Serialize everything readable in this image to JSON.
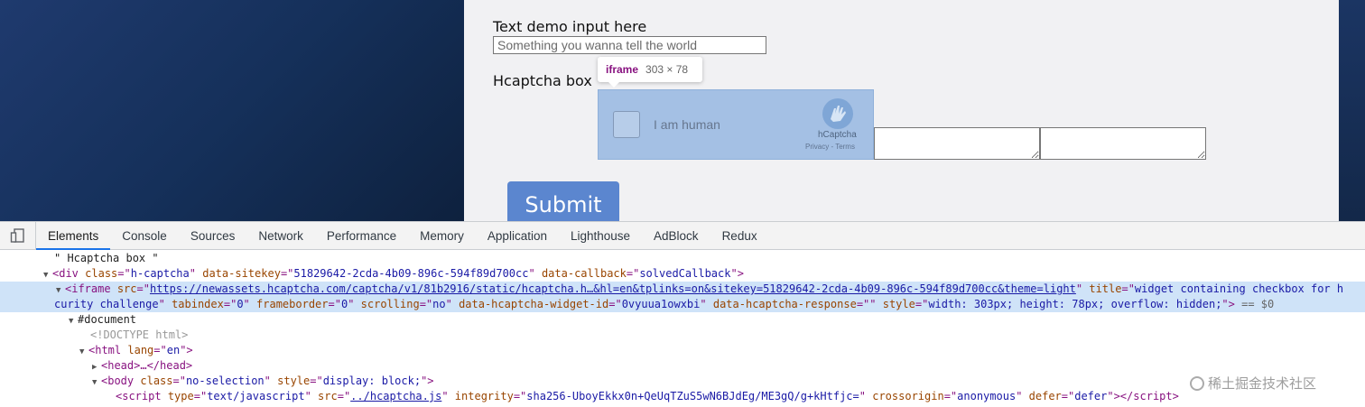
{
  "page": {
    "text_label": "Text demo input here",
    "text_placeholder": "Something you wanna tell the world",
    "captcha_label": "Hcaptcha box",
    "captcha_checkbox_text": "I am human",
    "captcha_brand": "hCaptcha",
    "captcha_links": "Privacy - Terms",
    "submit_label": "Submit"
  },
  "tooltip": {
    "tag": "iframe",
    "dims": "303 × 78"
  },
  "devtools": {
    "tabs": [
      "Elements",
      "Console",
      "Sources",
      "Network",
      "Performance",
      "Memory",
      "Application",
      "Lighthouse",
      "AdBlock",
      "Redux"
    ],
    "active_tab": "Elements"
  },
  "dom": {
    "text_node": "\" Hcaptcha box \"",
    "div_tag": "div",
    "div_class_attr": "class",
    "div_class_val": "h-captcha",
    "div_sitekey_attr": "data-sitekey",
    "div_sitekey_val": "51829642-2cda-4b09-896c-594f89d700cc",
    "div_callback_attr": "data-callback",
    "div_callback_val": "solvedCallback",
    "iframe_tag": "iframe",
    "iframe_src_attr": "src",
    "iframe_src_val": "https://newassets.hcaptcha.com/captcha/v1/81b2916/static/hcaptcha.h…&hl=en&tplinks=on&sitekey=51829642-2cda-4b09-896c-594f89d700cc&theme=light",
    "iframe_title_attr": "title",
    "iframe_title_val_a": "widget containing checkbox for h",
    "iframe_title_val_b": "curity challenge",
    "iframe_tabindex_attr": "tabindex",
    "iframe_tabindex_val": "0",
    "iframe_frameborder_attr": "frameborder",
    "iframe_frameborder_val": "0",
    "iframe_scrolling_attr": "scrolling",
    "iframe_scrolling_val": "no",
    "iframe_widgetid_attr": "data-hcaptcha-widget-id",
    "iframe_widgetid_val": "0vyuua1owxbi",
    "iframe_response_attr": "data-hcaptcha-response",
    "iframe_response_val": "",
    "iframe_style_attr": "style",
    "iframe_style_val": "width: 303px; height: 78px; overflow: hidden;",
    "selected_marker": "== $0",
    "document_node": "#document",
    "doctype": "<!DOCTYPE html>",
    "html_tag": "html",
    "html_lang_attr": "lang",
    "html_lang_val": "en",
    "head_collapsed": "<head>…</head>",
    "body_tag": "body",
    "body_class_attr": "class",
    "body_class_val": "no-selection",
    "body_style_attr": "style",
    "body_style_val": "display: block;",
    "script_tag": "script",
    "script_type_attr": "type",
    "script_type_val": "text/javascript",
    "script_src_attr": "src",
    "script_src_val": "../hcaptcha.js",
    "script_integrity_attr": "integrity",
    "script_integrity_val": "sha256-UboyEkkx0n+QeUqTZuS5wN6BJdEg/ME3gQ/g+kHtfjc=",
    "script_crossorigin_attr": "crossorigin",
    "script_crossorigin_val": "anonymous",
    "script_defer_attr": "defer",
    "script_defer_val": "defer"
  },
  "watermark": "稀土掘金技术社区",
  "colors": {
    "accent": "#1a73e8",
    "submit": "#5b86cf",
    "iframe_highlight": "#a4c0e4",
    "selected_row": "#cfe3f8"
  }
}
